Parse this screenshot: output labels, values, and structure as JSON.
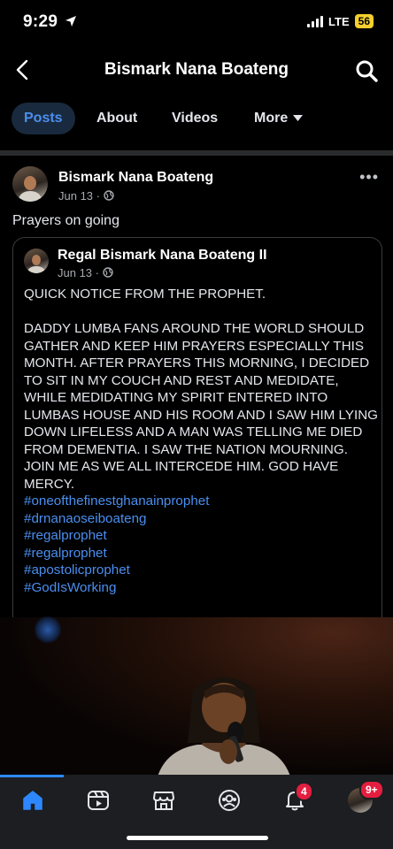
{
  "status_bar": {
    "time": "9:29",
    "network": "LTE",
    "battery": "56"
  },
  "header": {
    "title": "Bismark Nana Boateng"
  },
  "tabs": {
    "posts": "Posts",
    "about": "About",
    "videos": "Videos",
    "more": "More"
  },
  "post": {
    "author": "Bismark Nana Boateng",
    "date": "Jun 13 · ",
    "text": "Prayers on going",
    "shared": {
      "author": "Regal Bismark Nana Boateng II",
      "date": "Jun 13 · ",
      "notice": "QUICK NOTICE FROM THE PROPHET.",
      "body": "DADDY LUMBA FANS AROUND THE WORLD SHOULD GATHER AND KEEP HIM PRAYERS ESPECIALLY THIS MONTH.  AFTER PRAYERS THIS MORNING, I DECIDED TO SIT IN MY COUCH AND REST AND MEDIDATE, WHILE MEDIDATING MY SPIRIT ENTERED INTO LUMBAS HOUSE AND HIS ROOM AND I SAW HIM LYING DOWN LIFELESS AND A MAN WAS TELLING ME DIED FROM DEMENTIA. I SAW THE NATION MOURNING. JOIN ME AS WE ALL INTERCEDE HIM. GOD HAVE MERCY.",
      "hashtags": [
        "#oneofthefinestghanainprophet",
        "#drnanaoseiboateng",
        "#regalprophet",
        "#regalprophet",
        "#apostolicprophet",
        "#GodIsWorking"
      ]
    }
  },
  "bottom_nav": {
    "items": [
      {
        "icon": "home-icon",
        "active": true
      },
      {
        "icon": "video-icon"
      },
      {
        "icon": "marketplace-icon"
      },
      {
        "icon": "groups-icon"
      },
      {
        "icon": "notifications-icon",
        "badge": "4"
      },
      {
        "icon": "menu-avatar-icon",
        "badge": "9+"
      }
    ]
  },
  "colors": {
    "accent": "#2d88ff",
    "hashtag": "#4a8ff0",
    "badge": "#e41e3f",
    "battery": "#f5cf2b"
  }
}
